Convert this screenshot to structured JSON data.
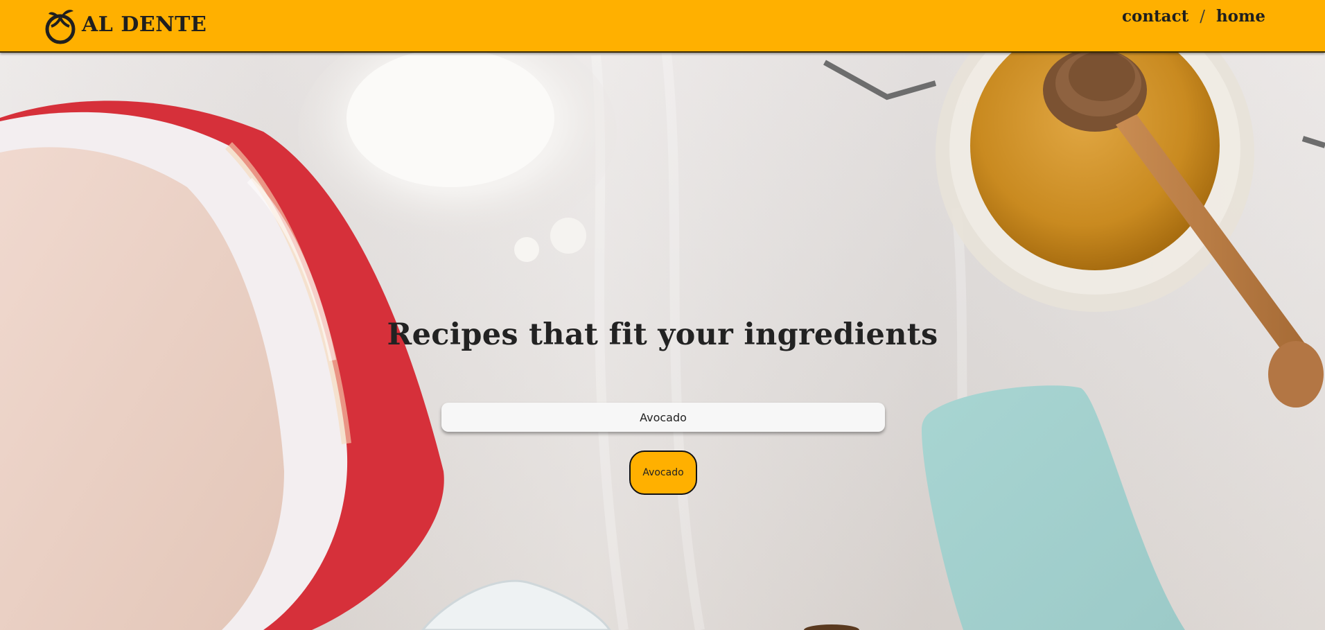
{
  "brand": {
    "name": "AL DENTE",
    "accent_color": "#ffb000",
    "logo_icon": "tomato-logo-icon"
  },
  "nav": {
    "contact": "contact",
    "separator": "/",
    "home": "home"
  },
  "hero": {
    "title": "Recipes that fit your ingredients"
  },
  "search": {
    "value": "Avocado",
    "button_label": "Avocado"
  },
  "background": {
    "description_icon": "kitchen-ingredients-photo"
  }
}
